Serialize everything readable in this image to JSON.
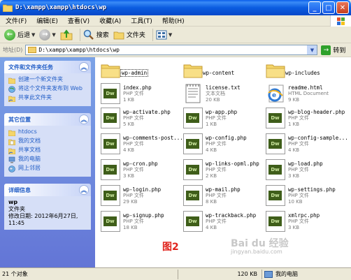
{
  "window": {
    "title": "D:\\xampp\\xampp\\htdocs\\wp"
  },
  "menu": [
    "文件(F)",
    "编辑(E)",
    "查看(V)",
    "收藏(A)",
    "工具(T)",
    "帮助(H)"
  ],
  "toolbar": {
    "back": "后退",
    "search": "搜索",
    "folders": "文件夹"
  },
  "address": {
    "label": "地址(D)",
    "value": "D:\\xampp\\xampp\\htdocs\\wp",
    "go": "转到"
  },
  "sidebar": {
    "tasks": {
      "title": "文件和文件夹任务",
      "items": [
        "创建一个新文件夹",
        "将这个文件夹发布到 Web",
        "共享此文件夹"
      ]
    },
    "places": {
      "title": "其它位置",
      "items": [
        "htdocs",
        "我的文档",
        "共享文档",
        "我的电脑",
        "网上邻居"
      ]
    },
    "details": {
      "title": "详细信息",
      "name": "wp",
      "type": "文件夹",
      "modified": "修改日期: 2012年6月27日, 11:45"
    }
  },
  "files": [
    {
      "name": "wp-admin",
      "kind": "folder"
    },
    {
      "name": "wp-content",
      "kind": "folder"
    },
    {
      "name": "wp-includes",
      "kind": "folder"
    },
    {
      "name": "index.php",
      "type": "PHP 文件",
      "size": "1 KB",
      "kind": "dw"
    },
    {
      "name": "license.txt",
      "type": "文本文档",
      "size": "20 KB",
      "kind": "txt"
    },
    {
      "name": "readme.html",
      "type": "HTML Document",
      "size": "9 KB",
      "kind": "html"
    },
    {
      "name": "wp-activate.php",
      "type": "PHP 文件",
      "size": "5 KB",
      "kind": "dw"
    },
    {
      "name": "wp-app.php",
      "type": "PHP 文件",
      "size": "1 KB",
      "kind": "dw"
    },
    {
      "name": "wp-blog-header.php",
      "type": "PHP 文件",
      "size": "1 KB",
      "kind": "dw"
    },
    {
      "name": "wp-comments-post...",
      "type": "PHP 文件",
      "size": "4 KB",
      "kind": "dw"
    },
    {
      "name": "wp-config.php",
      "type": "PHP 文件",
      "size": "4 KB",
      "kind": "dw"
    },
    {
      "name": "wp-config-sample...",
      "type": "PHP 文件",
      "size": "4 KB",
      "kind": "dw"
    },
    {
      "name": "wp-cron.php",
      "type": "PHP 文件",
      "size": "3 KB",
      "kind": "dw"
    },
    {
      "name": "wp-links-opml.php",
      "type": "PHP 文件",
      "size": "2 KB",
      "kind": "dw"
    },
    {
      "name": "wp-load.php",
      "type": "PHP 文件",
      "size": "3 KB",
      "kind": "dw"
    },
    {
      "name": "wp-login.php",
      "type": "PHP 文件",
      "size": "29 KB",
      "kind": "dw"
    },
    {
      "name": "wp-mail.php",
      "type": "PHP 文件",
      "size": "8 KB",
      "kind": "dw"
    },
    {
      "name": "wp-settings.php",
      "type": "PHP 文件",
      "size": "10 KB",
      "kind": "dw"
    },
    {
      "name": "wp-signup.php",
      "type": "PHP 文件",
      "size": "18 KB",
      "kind": "dw"
    },
    {
      "name": "wp-trackback.php",
      "type": "PHP 文件",
      "size": "4 KB",
      "kind": "dw"
    },
    {
      "name": "xmlrpc.php",
      "type": "PHP 文件",
      "size": "3 KB",
      "kind": "dw"
    }
  ],
  "caption": "图2",
  "watermark": {
    "main": "Bai du 经验",
    "sub": "jingyan.baidu.com"
  },
  "status": {
    "objects": "21 个对象",
    "size": "120 KB",
    "location": "我的电脑"
  },
  "colors": {
    "titlebar": "#0B5CE0",
    "sidebar": "#6F8DDF",
    "caption": "#E0231C"
  }
}
